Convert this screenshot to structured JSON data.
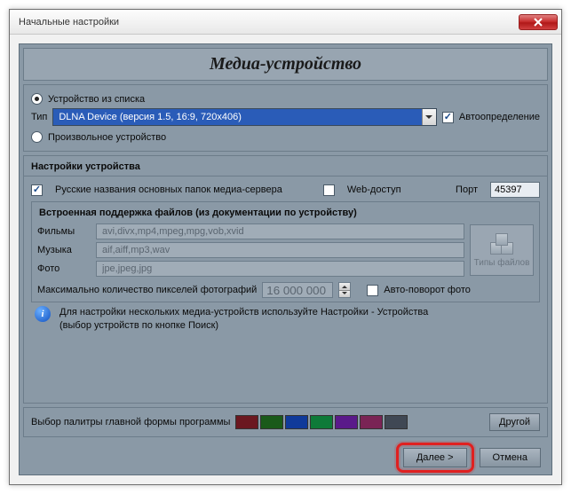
{
  "window": {
    "title": "Начальные настройки"
  },
  "heading": "Медиа-устройство",
  "deviceGroup": {
    "radioFromList": "Устройство из списка",
    "typeLabel": "Тип",
    "typeSelected": "DLNA Device (версия 1.5, 16:9, 720x406)",
    "autoDetect": "Автоопределение",
    "radioCustom": "Произвольное устройство"
  },
  "settings": {
    "title": "Настройки устройства",
    "russianFolders": "Русские названия основных папок медиа-сервера",
    "webAccess": "Web-доступ",
    "portLabel": "Порт",
    "portValue": "45397",
    "support": {
      "title": "Встроенная поддержка файлов (из документации по устройству)",
      "movies": {
        "label": "Фильмы",
        "value": "avi,divx,mp4,mpeg,mpg,vob,xvid"
      },
      "music": {
        "label": "Музыка",
        "value": "aif,aiff,mp3,wav"
      },
      "photo": {
        "label": "Фото",
        "value": "jpe,jpeg,jpg"
      },
      "fileTypesBtn": "Типы файлов",
      "maxPixLabel": "Максимально количество пикселей фотографий",
      "maxPixValue": "16 000 000",
      "autoRotate": "Авто-поворот фото"
    },
    "infoText1": "Для настройки нескольких медиа-устройств используйте Настройки - Устройства",
    "infoText2": "(выбор устройств по кнопке Поиск)"
  },
  "palette": {
    "label": "Выбор палитры главной формы программы",
    "colors": [
      "#6b1820",
      "#1a5a1a",
      "#103a9a",
      "#0e7a38",
      "#5a1a8a",
      "#7a2455",
      "#404854"
    ],
    "otherBtn": "Другой"
  },
  "footer": {
    "next": "Далее >",
    "cancel": "Отмена"
  },
  "chart_data": null
}
